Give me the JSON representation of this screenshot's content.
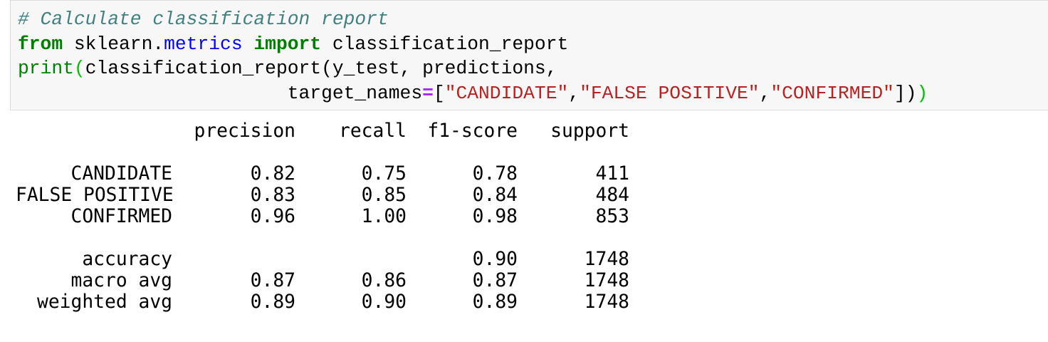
{
  "code": {
    "comment": "# Calculate classification report",
    "line2": {
      "kw_from": "from",
      "module_pre": " sklearn.",
      "module_attr": "metrics",
      "kw_import": "import",
      "name": " classification_report"
    },
    "line3": {
      "builtin_print": "print",
      "open_paren": "(",
      "call": "classification_report(y_test, predictions,"
    },
    "line4": {
      "indent": "                        ",
      "arg_name": "target_names",
      "eq": "=",
      "bracket_open": "[",
      "str1": "\"CANDIDATE\"",
      "comma1": ",",
      "str2": "\"FALSE POSITIVE\"",
      "comma2": ",",
      "str3": "\"CONFIRMED\"",
      "bracket_close": "])",
      "final_paren": ")"
    }
  },
  "report": {
    "headers": [
      "precision",
      "recall",
      "f1-score",
      "support"
    ],
    "class_rows": [
      {
        "label": "CANDIDATE",
        "precision": "0.82",
        "recall": "0.75",
        "f1": "0.78",
        "support": "411"
      },
      {
        "label": "FALSE POSITIVE",
        "precision": "0.83",
        "recall": "0.85",
        "f1": "0.84",
        "support": "484"
      },
      {
        "label": "CONFIRMED",
        "precision": "0.96",
        "recall": "1.00",
        "f1": "0.98",
        "support": "853"
      }
    ],
    "summary_rows": [
      {
        "label": "accuracy",
        "precision": "",
        "recall": "",
        "f1": "0.90",
        "support": "1748"
      },
      {
        "label": "macro avg",
        "precision": "0.87",
        "recall": "0.86",
        "f1": "0.87",
        "support": "1748"
      },
      {
        "label": "weighted avg",
        "precision": "0.89",
        "recall": "0.90",
        "f1": "0.89",
        "support": "1748"
      }
    ]
  }
}
